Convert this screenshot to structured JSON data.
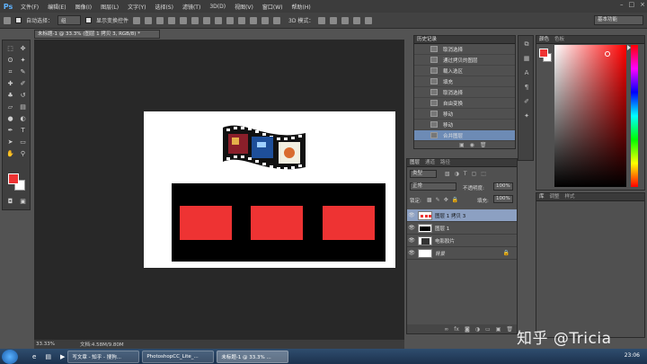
{
  "app": {
    "logo": "Ps"
  },
  "menu": {
    "items": [
      "文件(F)",
      "编辑(E)",
      "图像(I)",
      "图层(L)",
      "文字(Y)",
      "选择(S)",
      "滤镜(T)",
      "3D(D)",
      "视图(V)",
      "窗口(W)",
      "帮助(H)"
    ]
  },
  "window_controls": {
    "minimize": "–",
    "maximize": "□",
    "close": "×"
  },
  "options_bar": {
    "auto_select_label": "自动选择：",
    "auto_select_value": "组",
    "show_transform_label": "显示变换控件",
    "mode_3d_label": "3D 模式：",
    "workspace": "基本功能"
  },
  "document": {
    "tab_title": "未标题-1 @ 33.3% (图层 1 拷贝 3, RGB/8) *"
  },
  "status": {
    "zoom": "33.33%",
    "doc_size": "文档:4.58M/9.80M"
  },
  "history": {
    "tabs": [
      "历史记录"
    ],
    "items": [
      "取消选择",
      "通过拷贝的图层",
      "载入选区",
      "填充",
      "取消选择",
      "自由变换",
      "移动",
      "移动",
      "合并图层"
    ],
    "active_index": 8
  },
  "color_panel": {
    "tabs": [
      "颜色",
      "色板"
    ],
    "fg": "#ee3333",
    "bg": "#ffffff"
  },
  "swatch_panel": {
    "tabs": [
      "库",
      "调整",
      "样式"
    ]
  },
  "layers": {
    "tabs": [
      "图层",
      "通道",
      "路径"
    ],
    "filter_label": "类型",
    "blend_mode": "正常",
    "opacity_label": "不透明度:",
    "opacity_value": "100%",
    "lock_label": "锁定:",
    "fill_label": "填充:",
    "fill_value": "100%",
    "items": [
      {
        "name": "图层 1 拷贝 3",
        "active": true
      },
      {
        "name": "图层 1",
        "active": false
      },
      {
        "name": "电影胶片",
        "active": false
      },
      {
        "name": "背景",
        "active": false
      }
    ],
    "footer_icons": [
      "link-icon",
      "fx-icon",
      "mask-icon",
      "adjust-icon",
      "folder-icon",
      "new-layer-icon",
      "trash-icon"
    ]
  },
  "taskbar": {
    "items": [
      "写文章 - 知乎 - 搜狗...",
      "PhotoshopCC_Lite_...",
      "未标题-1 @ 33.3% ..."
    ],
    "clock": "23:06"
  },
  "watermark": "知乎 @Tricia"
}
